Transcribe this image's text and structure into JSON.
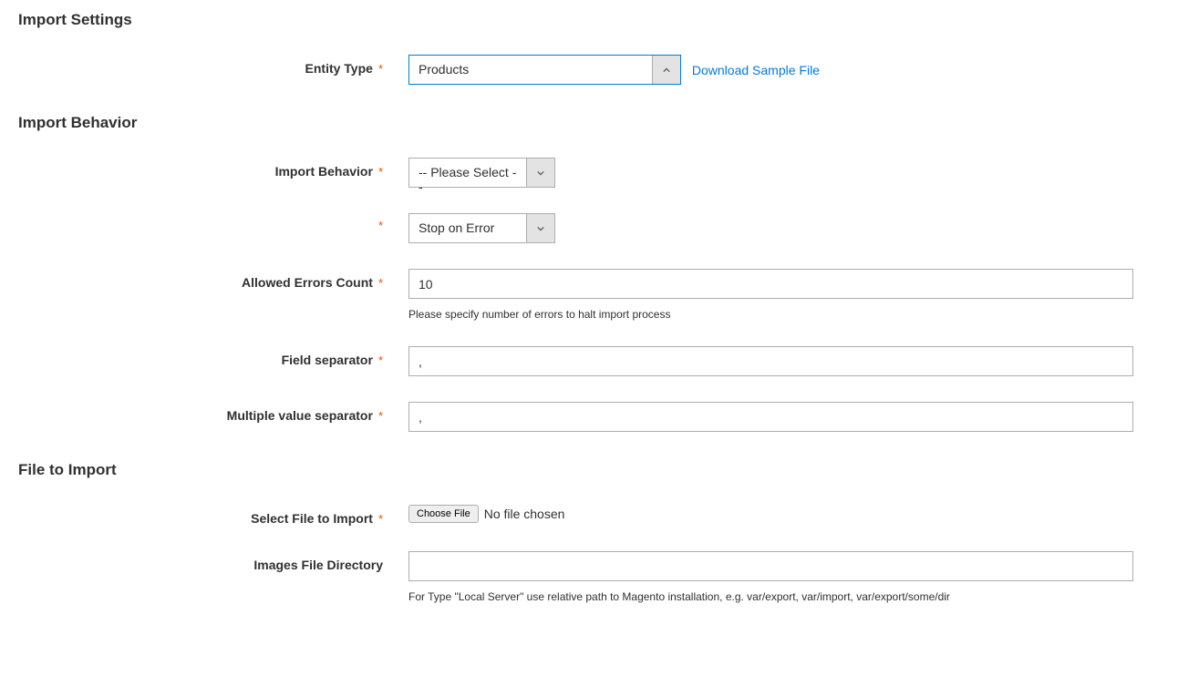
{
  "sections": {
    "import_settings": {
      "title": "Import Settings",
      "entity_type": {
        "label": "Entity Type",
        "value": "Products",
        "download_link": "Download Sample File"
      }
    },
    "import_behavior": {
      "title": "Import Behavior",
      "behavior": {
        "label": "Import Behavior",
        "value": "-- Please Select --"
      },
      "error_strategy": {
        "value": "Stop on Error"
      },
      "allowed_errors": {
        "label": "Allowed Errors Count",
        "value": "10",
        "note": "Please specify number of errors to halt import process"
      },
      "field_separator": {
        "label": "Field separator",
        "value": ","
      },
      "multi_value_separator": {
        "label": "Multiple value separator",
        "value": ","
      }
    },
    "file_to_import": {
      "title": "File to Import",
      "select_file": {
        "label": "Select File to Import",
        "button": "Choose File",
        "status": "No file chosen"
      },
      "images_dir": {
        "label": "Images File Directory",
        "value": "",
        "note": "For Type \"Local Server\" use relative path to Magento installation, e.g. var/export, var/import, var/export/some/dir"
      }
    }
  }
}
